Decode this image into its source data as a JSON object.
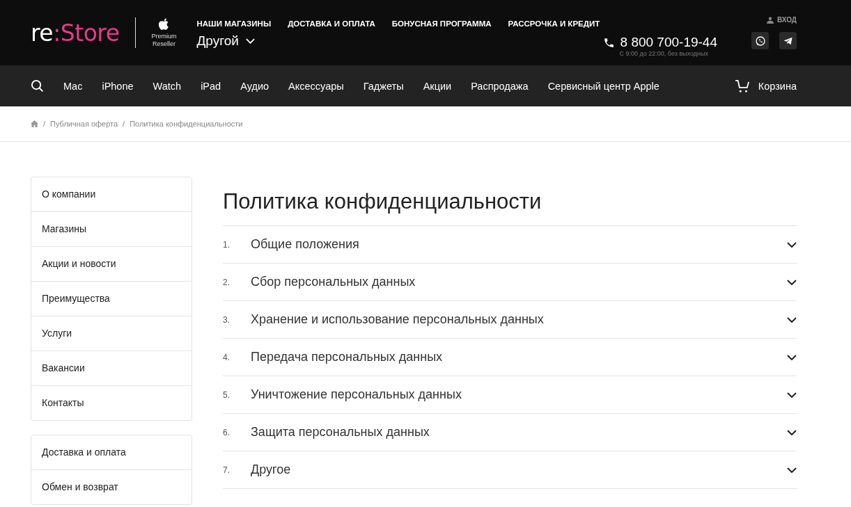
{
  "header": {
    "logo": {
      "part_1": "re",
      "part_2": ":Store"
    },
    "badge": {
      "line_1": "Premium",
      "line_2": "Reseller"
    },
    "top_links": [
      "НАШИ МАГАЗИНЫ",
      "ДОСТАВКА И ОПЛАТА",
      "БОНУСНАЯ ПРОГРАММА",
      "РАССРОЧКА И КРЕДИТ"
    ],
    "city": "Другой",
    "phone": "8 800 700-19-44",
    "hours": "С 9:00 до 22:00, без выходных",
    "login": "ВХОД"
  },
  "nav": {
    "items": [
      "Mac",
      "iPhone",
      "Watch",
      "iPad",
      "Аудио",
      "Аксессуары",
      "Гаджеты",
      "Акции",
      "Распродажа",
      "Сервисный центр Apple"
    ],
    "cart": "Корзина"
  },
  "breadcrumbs": [
    {
      "separator": "/",
      "label": "Публичная оферта"
    },
    {
      "separator": "/",
      "label": "Политика конфиденциальности"
    }
  ],
  "sidebar": {
    "groups": [
      [
        "О компании",
        "Магазины",
        "Акции и новости",
        "Преимущества",
        "Услуги",
        "Вакансии",
        "Контакты"
      ],
      [
        "Доставка и оплата",
        "Обмен и возврат"
      ]
    ]
  },
  "page": {
    "title": "Политика конфиденциальности",
    "sections": [
      {
        "number": "1.",
        "title": "Общие положения",
        "expanded": false
      },
      {
        "number": "2.",
        "title": "Сбор персональных данных",
        "expanded": false
      },
      {
        "number": "3.",
        "title": "Хранение и использование персональных данных",
        "expanded": false
      },
      {
        "number": "4.",
        "title": "Передача персональных данных",
        "expanded": false
      },
      {
        "number": "5.",
        "title": "Уничтожение персональных данных",
        "expanded": false
      },
      {
        "number": "6.",
        "title": "Защита персональных данных",
        "expanded": false
      },
      {
        "number": "7.",
        "title": "Другое",
        "expanded": false
      }
    ]
  }
}
